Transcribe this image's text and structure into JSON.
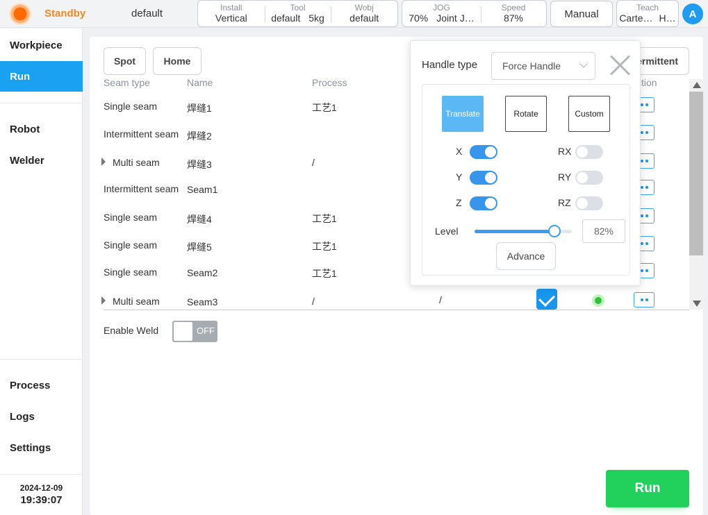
{
  "header": {
    "status": "Standby",
    "project": "default",
    "group1": [
      {
        "label": "Install",
        "value": "Vertical"
      },
      {
        "label": "Tool",
        "value": "default",
        "value2": "5kg"
      },
      {
        "label": "Wobj",
        "value": "default"
      }
    ],
    "group2": [
      {
        "label": "JOG",
        "value": "70%",
        "value2": "Joint J…"
      },
      {
        "label": "Speed",
        "value": "87%"
      }
    ],
    "mode_button": "Manual",
    "teach": {
      "label": "Teach",
      "value": "Carte…",
      "value2": "H…"
    },
    "avatar": "A"
  },
  "sidebar": {
    "items": [
      "Workpiece",
      "Run",
      "Robot",
      "Welder",
      "Process",
      "Logs",
      "Settings"
    ],
    "active": "Run",
    "date": "2024-12-09",
    "time": "19:39:07"
  },
  "toolbar": {
    "spot": "Spot",
    "home": "Home",
    "intermittent_partial": "ermittent"
  },
  "table": {
    "headers": {
      "seam_type": "Seam type",
      "name": "Name",
      "process": "Process",
      "action_partial": "ction"
    },
    "rows": [
      {
        "type": "Single seam",
        "name": "焊缝1",
        "process": "工艺1",
        "col4": ""
      },
      {
        "type": "Intermittent seam",
        "name": "焊缝2",
        "process": "",
        "col4": ""
      },
      {
        "type": "Multi seam",
        "name": "焊缝3",
        "process": "/",
        "col4": ""
      },
      {
        "type": "Intermittent seam",
        "name": "Seam1",
        "process": "",
        "col4": ""
      },
      {
        "type": "Single seam",
        "name": "焊缝4",
        "process": "工艺1",
        "col4": ""
      },
      {
        "type": "Single seam",
        "name": "焊缝5",
        "process": "工艺1",
        "col4": ""
      },
      {
        "type": "Single seam",
        "name": "Seam2",
        "process": "工艺1",
        "col4": ""
      },
      {
        "type": "Multi seam",
        "name": "Seam3",
        "process": "/",
        "col4": "/"
      }
    ],
    "last_row_checked": true
  },
  "enable_weld": {
    "label": "Enable Weld",
    "state": "OFF"
  },
  "run_button": "Run",
  "popup": {
    "handle_type_label": "Handle type",
    "handle_type_value": "Force Handle",
    "modes": [
      "Translate",
      "Rotate",
      "Custom"
    ],
    "active_mode": "Translate",
    "axes": [
      {
        "name": "X",
        "on": true
      },
      {
        "name": "Y",
        "on": true
      },
      {
        "name": "Z",
        "on": true
      },
      {
        "name": "RX",
        "on": false
      },
      {
        "name": "RY",
        "on": false
      },
      {
        "name": "RZ",
        "on": false
      }
    ],
    "level_label": "Level",
    "level_value": "82%",
    "level_fraction": 0.82,
    "advance_label": "Advance"
  },
  "colors": {
    "accent": "#1ba1f2",
    "status": "#f08a24",
    "run": "#22d05c",
    "switch_on": "#3796eb"
  }
}
